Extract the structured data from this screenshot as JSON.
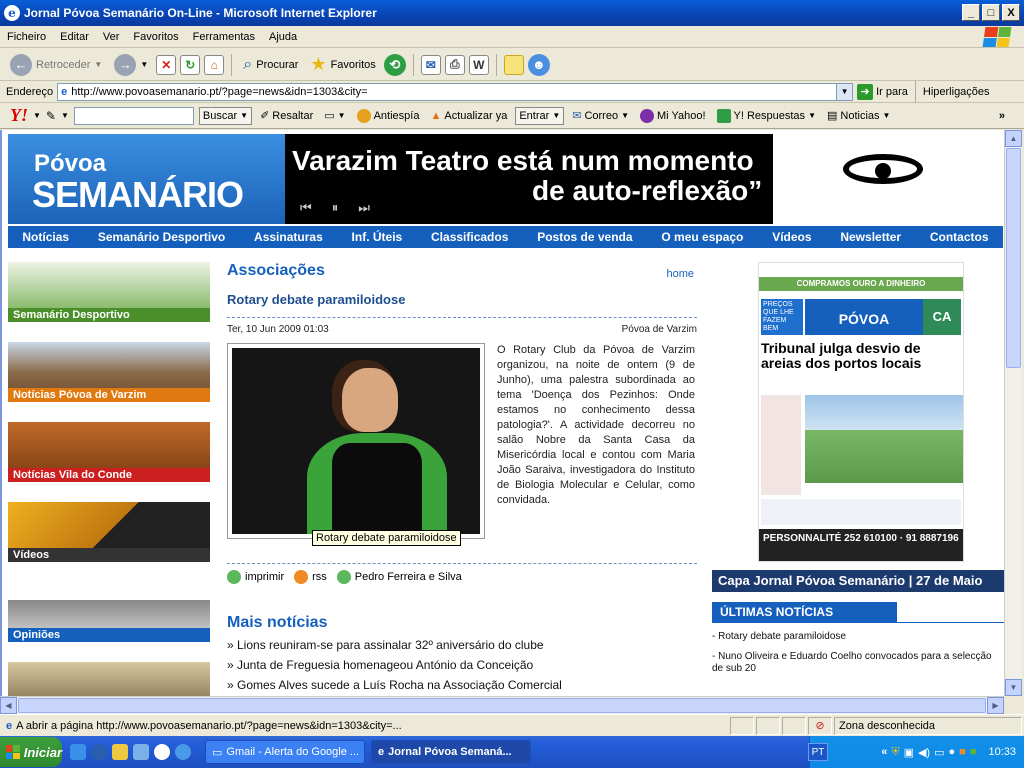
{
  "window": {
    "title": "Jornal Póvoa Semanário On-Line - Microsoft Internet Explorer",
    "controls": {
      "minimize": "_",
      "maximize": "□",
      "close": "X"
    }
  },
  "menu": [
    "Ficheiro",
    "Editar",
    "Ver",
    "Favoritos",
    "Ferramentas",
    "Ajuda"
  ],
  "toolbar": {
    "back": "Retroceder",
    "search": "Procurar",
    "favorites": "Favoritos"
  },
  "address": {
    "label": "Endereço",
    "url": "http://www.povoasemanario.pt/?page=news&idn=1303&city=",
    "go": "Ir para",
    "links": "Hiperligações"
  },
  "yahoo": {
    "logo": "Y!",
    "search": "Buscar",
    "highlight": "Resaltar",
    "antispy": "Antiespía",
    "update": "Actualizar ya",
    "enter": "Entrar",
    "mail": "Correo",
    "myyahoo": "Mi Yahoo!",
    "answers": "Y! Respuestas",
    "news": "Noticias",
    "more": "»"
  },
  "banner": {
    "logo_top": "Póvoa",
    "logo_bottom": "SEMANÁRIO",
    "headline_1": "Varazim Teatro está num momento",
    "headline_2": "de auto-reflexão”",
    "controls": [
      "⏮",
      "⏸",
      "⏭"
    ]
  },
  "nav": [
    "Notícias",
    "Semanário Desportivo",
    "Assinaturas",
    "Inf. Úteis",
    "Classificados",
    "Postos de venda",
    "O meu espaço",
    "Vídeos",
    "Newsletter",
    "Contactos"
  ],
  "left": [
    {
      "caption": "Semanário Desportivo",
      "color": "#4a8f2a",
      "bg": "#5aa040"
    },
    {
      "caption": "Notícias Póvoa de Varzim",
      "color": "#e07a10",
      "bg": "#8b6b4a"
    },
    {
      "caption": "Notícias Vila do Conde",
      "color": "#cc1f1f",
      "bg": "#a0521a"
    },
    {
      "caption": "Vídeos",
      "color": "#333333",
      "bg": "#e0a020"
    },
    {
      "caption": "Opiniões",
      "color": "#1560bd",
      "bg": "#cfcfcf"
    }
  ],
  "article": {
    "section": "Associações",
    "home": "home",
    "title": "Rotary debate paramiloidose",
    "date": "Ter, 10 Jun 2009 01:03",
    "place": "Póvoa de Varzim",
    "body": "O Rotary Club da Póvoa de Varzim organizou, na noite de ontem (9 de Junho), uma palestra subordinada ao tema 'Doença dos Pezinhos: Onde estamos no conhecimento dessa patologia?'. A actividade decorreu no salão Nobre da Santa Casa da Misericórdia local e contou com Maria João Saraiva, investigadora do Instituto de Biologia Molecular e Celular, como convidada.",
    "tooltip": "Rotary debate paramiloidose",
    "print": "imprimir",
    "rss": "rss",
    "author": "Pedro Ferreira e Silva"
  },
  "more": {
    "title": "Mais notícias",
    "items": [
      "» Lions reuniram-se para assinalar 32º aniversário do clube",
      "» Junta de Freguesia homenageou António da Conceição",
      "» Gomes Alves sucede a Luís Rocha na Associação Comercial"
    ]
  },
  "right": {
    "cover_top": "COMPRAMOS OURO A DINHEIRO",
    "cover_logo": "PÓVOA SEMANÁRIO",
    "cover_promo": "PREÇOS QUE LHE FAZEM BEM",
    "cover_ca": "CA",
    "cover_headline": "Tribunal julga desvio de areias dos portos locais",
    "cover_ad": "PERSONNALITÉ 252 610100 · 91 8887196",
    "capa": "Capa Jornal Póvoa Semanário | 27 de Maio",
    "ultimas": "ÚLTIMAS NOTÍCIAS",
    "items": [
      "- Rotary debate paramiloidose",
      "- Nuno Oliveira e Eduardo Coelho convocados para a selecção de sub 20"
    ]
  },
  "status": {
    "text": "A abrir a página http://www.povoasemanario.pt/?page=news&idn=1303&city=...",
    "zone": "Zona desconhecida"
  },
  "taskbar": {
    "start": "Iniciar",
    "tasks": [
      "Gmail - Alerta do Google ...",
      "Jornal Póvoa Semaná..."
    ],
    "lang": "PT",
    "time": "10:33"
  }
}
